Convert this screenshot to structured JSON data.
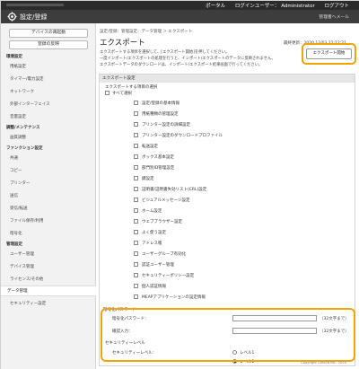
{
  "topbar": {
    "portal": "ポータル",
    "login_user": "ログインユーザー：",
    "user": "Administrator",
    "logout": "ログアウト"
  },
  "header": {
    "title": "設定/登録",
    "admin_mail": "管理者へメール"
  },
  "sidebar": {
    "device_btn": "デバイスの再起動",
    "register_btn": "登録の反映",
    "sections": [
      {
        "head": "環境設定",
        "items": [
          "用紙設定",
          "タイマー/電力設定",
          "ネットワーク",
          "外部インターフェイス",
          "音量設定"
        ]
      },
      {
        "head": "調整/メンテナンス",
        "items": [
          "画質調整"
        ]
      },
      {
        "head": "ファンクション設定",
        "items": [
          "共通",
          "コピー",
          "プリンター",
          "送信",
          "受信/転送",
          "ファイル保存/利用",
          "暗号化"
        ]
      },
      {
        "head": "管理設定",
        "items": [
          "ユーザー管理",
          "デバイス管理",
          "ライセンス/その他",
          "データ管理",
          "セキュリティー設定"
        ]
      }
    ],
    "selected": "データ管理"
  },
  "main": {
    "breadcrumb": "設定/登録：管理設定：データ管理 ＞ エクスポート",
    "title": "エクスポート",
    "updated": "最終更新：2020 12/03 22:12:21",
    "desc1": "エクスポートする項目を選択して、[エクスポート開始]を押してください。",
    "desc2": "一度インポート/エクスポートの処理を行うと、インポート/エクスポートのデータに反映されません。",
    "desc3": "エクスポートデータのダウンロードは、インポート/エクスポート結果画面で行ってください。",
    "export_btn": "エクスポート開始",
    "panel_head": "エクスポート設定",
    "select_items_label": "エクスポートする項目の選択",
    "select_all": "すべて選択",
    "items": [
      "設定/登録の基本情報",
      "用紙種類の管理設定",
      "プリンター設定の詳細設定",
      "プリンター設定のダウンロードプロファイル",
      "転送設定",
      "ボックス基本設定",
      "部門別ID管理設定",
      "鍵設定",
      "証明書/証明書失効リスト(CRL)設定",
      "ビジュアルメッセージ設定",
      "ホーム設定",
      "ウェブブラウザー設定",
      "よく使う設定",
      "アドレス帳",
      "ユーザーグループ有効化",
      "認証ユーザー管理",
      "セキュリティーポリシー設定",
      "個人認証情報",
      "MEAPアプリケーションの設定情報"
    ],
    "encrypt_head": "暗号化パスワード",
    "password_label": "暗号化パスワード：",
    "confirm_label": "確認入力：",
    "max_note": "（32文字まで）",
    "security_level": "セキュリティーレベル",
    "security_level_label": "セキュリティーレベル：",
    "level1": "レベル1",
    "level2": "レベル2",
    "footer": "Copyright CANON INC. 2020"
  }
}
